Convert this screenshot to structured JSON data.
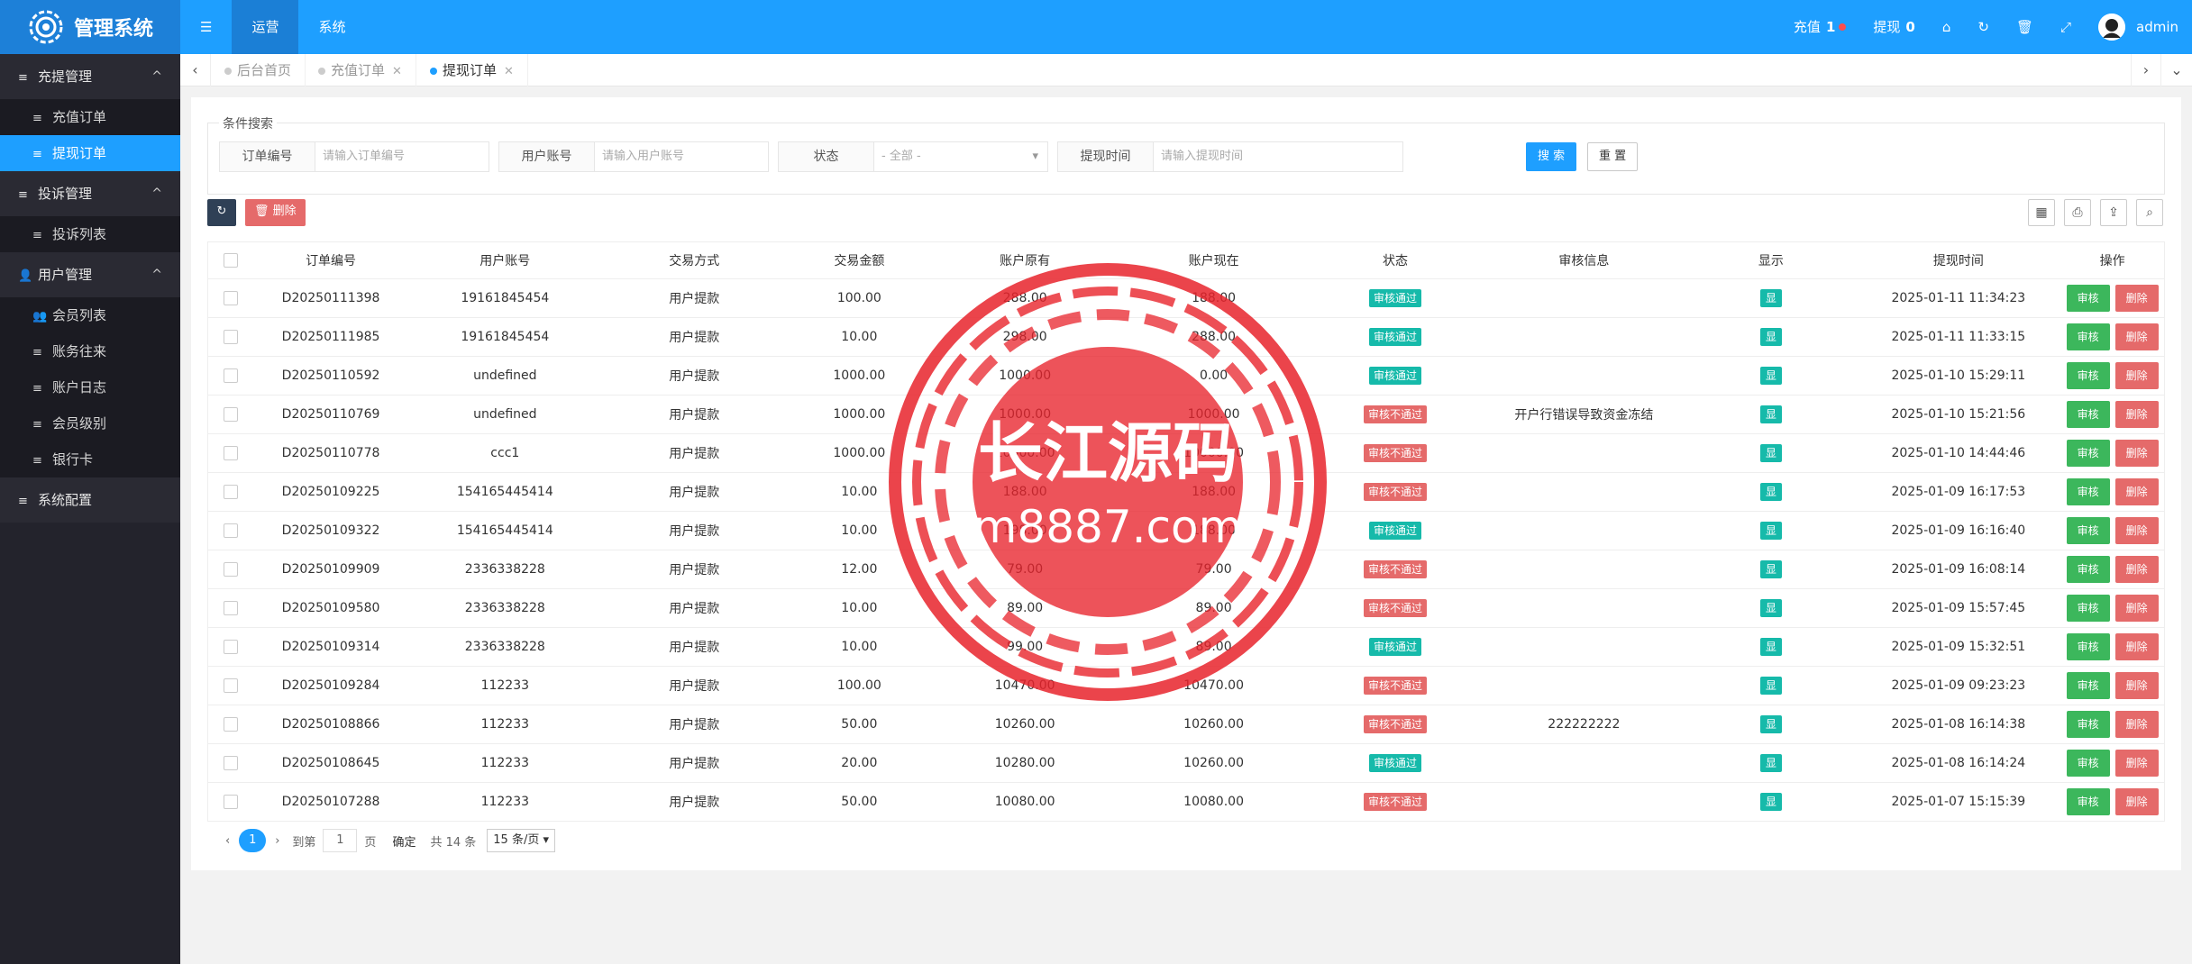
{
  "header": {
    "app_title": "管理系统",
    "menu_icon": "menu-icon",
    "nav": [
      "运营",
      "系统"
    ],
    "recharge_label": "充值",
    "recharge_count": "1",
    "withdraw_label": "提现",
    "withdraw_count": "0",
    "user": "admin"
  },
  "sidebar": {
    "groups": [
      {
        "label": "充提管理",
        "items": [
          "充值订单",
          "提现订单"
        ]
      },
      {
        "label": "投诉管理",
        "items": [
          "投诉列表"
        ]
      },
      {
        "label": "用户管理",
        "items": [
          "会员列表",
          "账务往来",
          "账户日志",
          "会员级别",
          "银行卡"
        ]
      },
      {
        "label": "系统配置",
        "items": []
      }
    ],
    "active_item": "提现订单"
  },
  "tabs": [
    "后台首页",
    "充值订单",
    "提现订单"
  ],
  "search": {
    "legend": "条件搜索",
    "order_no_label": "订单编号",
    "order_no_placeholder": "请输入订单编号",
    "account_label": "用户账号",
    "account_placeholder": "请输入用户账号",
    "status_label": "状态",
    "status_value": "- 全部 -",
    "time_label": "提现时间",
    "time_placeholder": "请输入提现时间",
    "search_btn": "搜 索",
    "reset_btn": "重 置"
  },
  "toolbar": {
    "delete_btn": "删除"
  },
  "table": {
    "columns": [
      "订单编号",
      "用户账号",
      "交易方式",
      "交易金额",
      "账户原有",
      "账户现在",
      "状态",
      "审核信息",
      "显示",
      "提现时间",
      "操作"
    ],
    "show_label": "显",
    "approve_label": "审核",
    "delete_label": "删除",
    "rows": [
      [
        "D20250111398",
        "19161845454",
        "用户提款",
        "100.00",
        "288.00",
        "188.00",
        "审核通过",
        "",
        "2025-01-11 11:34:23"
      ],
      [
        "D20250111985",
        "19161845454",
        "用户提款",
        "10.00",
        "298.00",
        "288.00",
        "审核通过",
        "",
        "2025-01-11 11:33:15"
      ],
      [
        "D20250110592",
        "undefined",
        "用户提款",
        "1000.00",
        "1000.00",
        "0.00",
        "审核通过",
        "",
        "2025-01-10 15:29:11"
      ],
      [
        "D20250110769",
        "undefined",
        "用户提款",
        "1000.00",
        "1000.00",
        "1000.00",
        "审核不通过",
        "开户行错误导致资金冻结",
        "2025-01-10 15:21:56"
      ],
      [
        "D20250110778",
        "ccc1",
        "用户提款",
        "1000.00",
        "10000.00",
        "10000.00",
        "审核不通过",
        "",
        "2025-01-10 14:44:46"
      ],
      [
        "D20250109225",
        "154165445414",
        "用户提款",
        "10.00",
        "188.00",
        "188.00",
        "审核不通过",
        "",
        "2025-01-09 16:17:53"
      ],
      [
        "D20250109322",
        "154165445414",
        "用户提款",
        "10.00",
        "198.00",
        "188.00",
        "审核通过",
        "",
        "2025-01-09 16:16:40"
      ],
      [
        "D20250109909",
        "2336338228",
        "用户提款",
        "12.00",
        "79.00",
        "79.00",
        "审核不通过",
        "",
        "2025-01-09 16:08:14"
      ],
      [
        "D20250109580",
        "2336338228",
        "用户提款",
        "10.00",
        "89.00",
        "89.00",
        "审核不通过",
        "",
        "2025-01-09 15:57:45"
      ],
      [
        "D20250109314",
        "2336338228",
        "用户提款",
        "10.00",
        "99.00",
        "89.00",
        "审核通过",
        "",
        "2025-01-09 15:32:51"
      ],
      [
        "D20250109284",
        "112233",
        "用户提款",
        "100.00",
        "10470.00",
        "10470.00",
        "审核不通过",
        "",
        "2025-01-09 09:23:23"
      ],
      [
        "D20250108866",
        "112233",
        "用户提款",
        "50.00",
        "10260.00",
        "10260.00",
        "审核不通过",
        "222222222",
        "2025-01-08 16:14:38"
      ],
      [
        "D20250108645",
        "112233",
        "用户提款",
        "20.00",
        "10280.00",
        "10260.00",
        "审核通过",
        "",
        "2025-01-08 16:14:24"
      ],
      [
        "D20250107288",
        "112233",
        "用户提款",
        "50.00",
        "10080.00",
        "10080.00",
        "审核不通过",
        "",
        "2025-01-07 15:15:39"
      ]
    ]
  },
  "pager": {
    "current": "1",
    "goto_label": "到第",
    "page_input": "1",
    "page_unit": "页",
    "confirm": "确定",
    "total": "共 14 条",
    "per_page": "15 条/页"
  },
  "watermark": {
    "text1": "长江源码",
    "text2": "m8887.com"
  },
  "colors": {
    "primary": "#1e9fff",
    "ok": "#16baaa",
    "fail": "#e56a6a",
    "approve": "#3cb75c"
  }
}
